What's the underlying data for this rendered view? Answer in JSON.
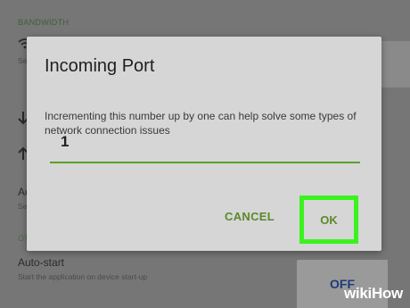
{
  "background": {
    "section_bandwidth": "BANDWIDTH",
    "row_wifi_icon": "wifi-icon",
    "row_wifi_sub": "Se",
    "row_down_icon": "arrow-down-icon",
    "row_up_icon": "arrow-up-icon",
    "row_a_label": "Ac",
    "row_a_sub": "Se",
    "section_other": "OT",
    "autostart_label": "Auto-start",
    "autostart_sub": "Start the application on device start-up",
    "toggle_label": "OFF"
  },
  "dialog": {
    "title": "Incoming Port",
    "message": "Incrementing this number up by one can help solve some types of network connection issues",
    "value": "1",
    "cancel_label": "CANCEL",
    "ok_label": "OK"
  },
  "watermark": {
    "brand": "wiki",
    "brand_suffix": "How"
  },
  "colors": {
    "accent": "#5aa02c",
    "highlight": "#3bf21e",
    "toggle_text": "#1e3c7a"
  }
}
